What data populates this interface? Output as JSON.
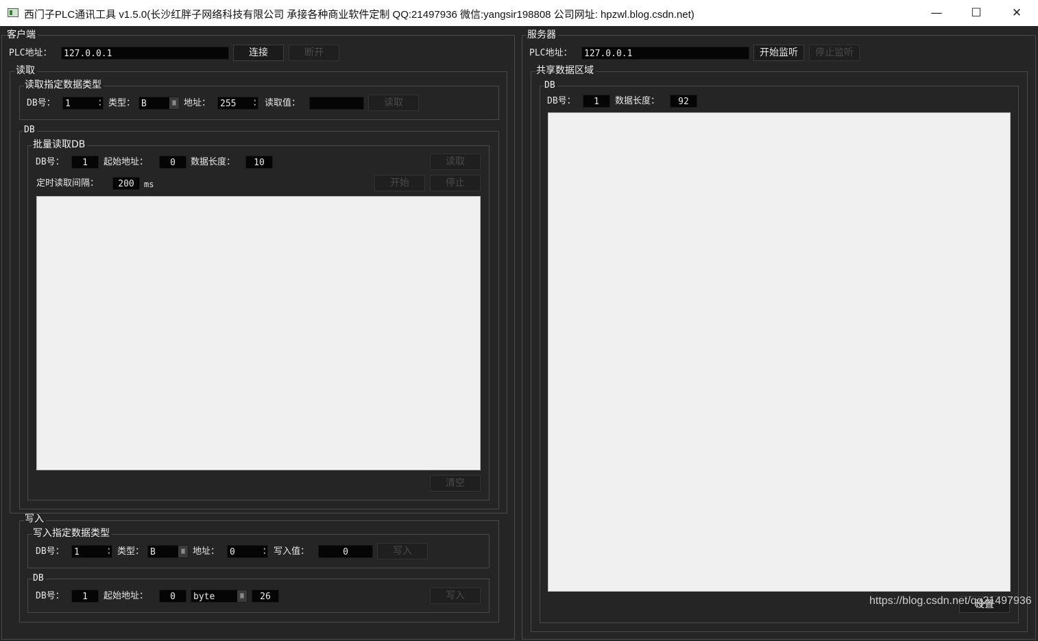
{
  "window": {
    "title": "西门子PLC通讯工具 v1.5.0(长沙红胖子网络科技有限公司 承接各种商业软件定制 QQ:21497936 微信:yangsir198808 公司网址: hpzwl.blog.csdn.net)",
    "minimize": "—",
    "maximize": "☐",
    "close": "✕"
  },
  "client": {
    "title": "客户端",
    "plc_label": "PLC地址：",
    "plc_value": "127.0.0.1",
    "connect": "连接",
    "disconnect": "断开",
    "read": {
      "title": "读取",
      "specific": {
        "title": "读取指定数据类型",
        "db_label": "DB号：",
        "db_value": "1",
        "type_label": "类型：",
        "type_value": "B",
        "addr_label": "地址：",
        "addr_value": "255",
        "value_label": "读取值：",
        "value": "",
        "read_btn": "读取"
      },
      "db": {
        "title": "DB",
        "batch": {
          "title": "批量读取DB",
          "db_label": "DB号：",
          "db_value": "1",
          "start_label": "起始地址：",
          "start_value": "0",
          "len_label": "数据长度：",
          "len_value": "10",
          "read_btn": "读取",
          "interval_label": "定时读取间隔：",
          "interval_value": "200",
          "interval_unit": "ms",
          "start_btn": "开始",
          "stop_btn": "停止",
          "clear_btn": "清空"
        }
      }
    },
    "write": {
      "title": "写入",
      "specific": {
        "title": "写入指定数据类型",
        "db_label": "DB号：",
        "db_value": "1",
        "type_label": "类型：",
        "type_value": "B",
        "addr_label": "地址：",
        "addr_value": "0",
        "value_label": "写入值：",
        "value": "0",
        "write_btn": "写入"
      },
      "db": {
        "title": "DB",
        "db_label": "DB号：",
        "db_value": "1",
        "start_label": "起始地址：",
        "start_value": "0",
        "type_value": "byte",
        "value": "26",
        "write_btn": "写入"
      }
    }
  },
  "server": {
    "title": "服务器",
    "plc_label": "PLC地址：",
    "plc_value": "127.0.0.1",
    "start_listen": "开始监听",
    "stop_listen": "停止监听",
    "shared": {
      "title": "共享数据区域",
      "db": {
        "title": "DB",
        "db_label": "DB号：",
        "db_value": "1",
        "len_label": "数据长度：",
        "len_value": "92",
        "set_btn": "设置"
      }
    }
  },
  "watermark": "https://blog.csdn.net/qq21497936"
}
